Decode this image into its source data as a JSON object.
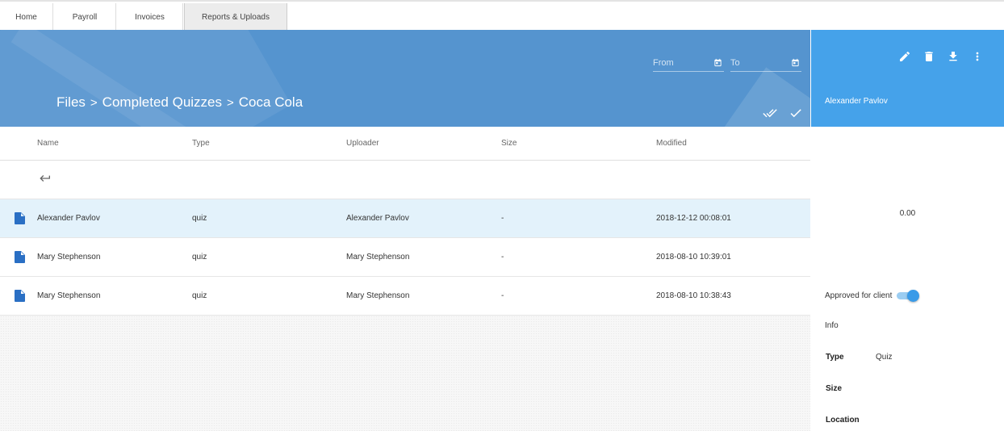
{
  "tabs": [
    {
      "label": "Home"
    },
    {
      "label": "Payroll"
    },
    {
      "label": "Invoices"
    },
    {
      "label": "Reports & Uploads",
      "active": true
    }
  ],
  "header": {
    "breadcrumb": [
      "Files",
      "Completed Quizzes",
      "Coca Cola"
    ],
    "breadcrumb_separator": ">",
    "date_from_placeholder": "From",
    "date_to_placeholder": "To",
    "icons": [
      "calendar-icon",
      "double-check-icon",
      "check-icon"
    ]
  },
  "table": {
    "columns": [
      "Name",
      "Type",
      "Uploader",
      "Size",
      "Modified"
    ],
    "rows": [
      {
        "name": "Alexander Pavlov",
        "type": "quiz",
        "uploader": "Alexander Pavlov",
        "size": "-",
        "modified": "2018-12-12 00:08:01",
        "selected": true
      },
      {
        "name": "Mary Stephenson",
        "type": "quiz",
        "uploader": "Mary Stephenson",
        "size": "-",
        "modified": "2018-08-10 10:39:01",
        "selected": false
      },
      {
        "name": "Mary Stephenson",
        "type": "quiz",
        "uploader": "Mary Stephenson",
        "size": "-",
        "modified": "2018-08-10 10:38:43",
        "selected": false
      }
    ]
  },
  "panel": {
    "title": "Alexander Pavlov",
    "value": "0.00",
    "approved_label": "Approved for client",
    "approved": true,
    "info_label": "Info",
    "type_label": "Type",
    "type_value": "Quiz",
    "size_label": "Size",
    "location_label": "Location",
    "icons": [
      "edit-icon",
      "delete-icon",
      "download-icon",
      "more-vert-icon"
    ]
  },
  "colors": {
    "header_blue": "#5594cf",
    "panel_blue": "#45a2ea",
    "selected_row": "#e3f2fb",
    "file_icon": "#2a6fc4",
    "toggle": "#3a9be8"
  }
}
